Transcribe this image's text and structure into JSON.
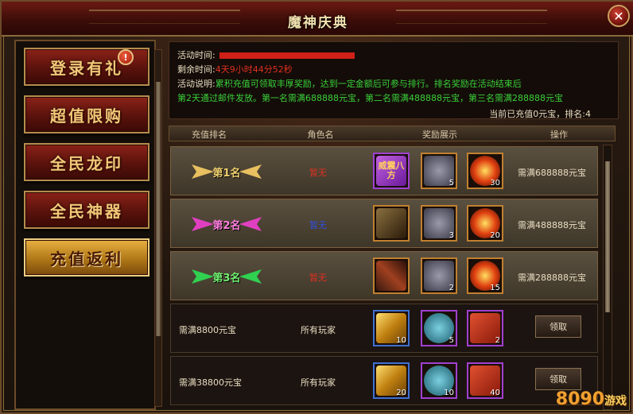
{
  "window": {
    "title": "魔神庆典",
    "close_label": "✕"
  },
  "sidebar": {
    "badge": "!",
    "items": [
      {
        "label": "登录有礼",
        "active": false
      },
      {
        "label": "超值限购",
        "active": false
      },
      {
        "label": "全民龙印",
        "active": false
      },
      {
        "label": "全民神器",
        "active": false
      },
      {
        "label": "充值返利",
        "active": true
      }
    ]
  },
  "info": {
    "time_label": "活动时间:",
    "remain_label": "剩余时间:",
    "remain_value": "4天9小时44分52秒",
    "desc_label": "活动说明:",
    "desc_line1": "累积充值可领取丰厚奖励，达到一定金额后可参与排行。排名奖励在活动结束后",
    "desc_line2": "第2天通过邮件发放。第一名需满688888元宝，第二名需满488888元宝，第三名需满288888元宝",
    "status": "当前已充值0元宝，排名:4"
  },
  "table": {
    "headers": {
      "rank": "充值排名",
      "role": "角色名",
      "reward": "奖励展示",
      "action": "操作"
    },
    "ranked_rows": [
      {
        "rank": "第1名",
        "role": "暂无",
        "cond": "需满688888元宝",
        "item1_text": "威震八方",
        "counts": [
          "",
          "5",
          "30"
        ]
      },
      {
        "rank": "第2名",
        "role": "暂无",
        "cond": "需满488888元宝",
        "counts": [
          "",
          "3",
          "20"
        ]
      },
      {
        "rank": "第3名",
        "role": "暂无",
        "cond": "需满288888元宝",
        "counts": [
          "",
          "2",
          "15"
        ]
      }
    ],
    "plain_rows": [
      {
        "cond": "需满8800元宝",
        "who": "所有玩家",
        "counts": [
          "10",
          "5",
          "2"
        ],
        "action": "领取"
      },
      {
        "cond": "需满38800元宝",
        "who": "所有玩家",
        "counts": [
          "20",
          "10",
          "40"
        ],
        "action": "领取"
      }
    ]
  },
  "watermark": {
    "text": "8090",
    "sub": "游戏"
  },
  "colors": {
    "gold": "#e8c060",
    "pink": "#e040c0",
    "green": "#30d050",
    "red": "#e03020",
    "blue": "#3050e0"
  }
}
